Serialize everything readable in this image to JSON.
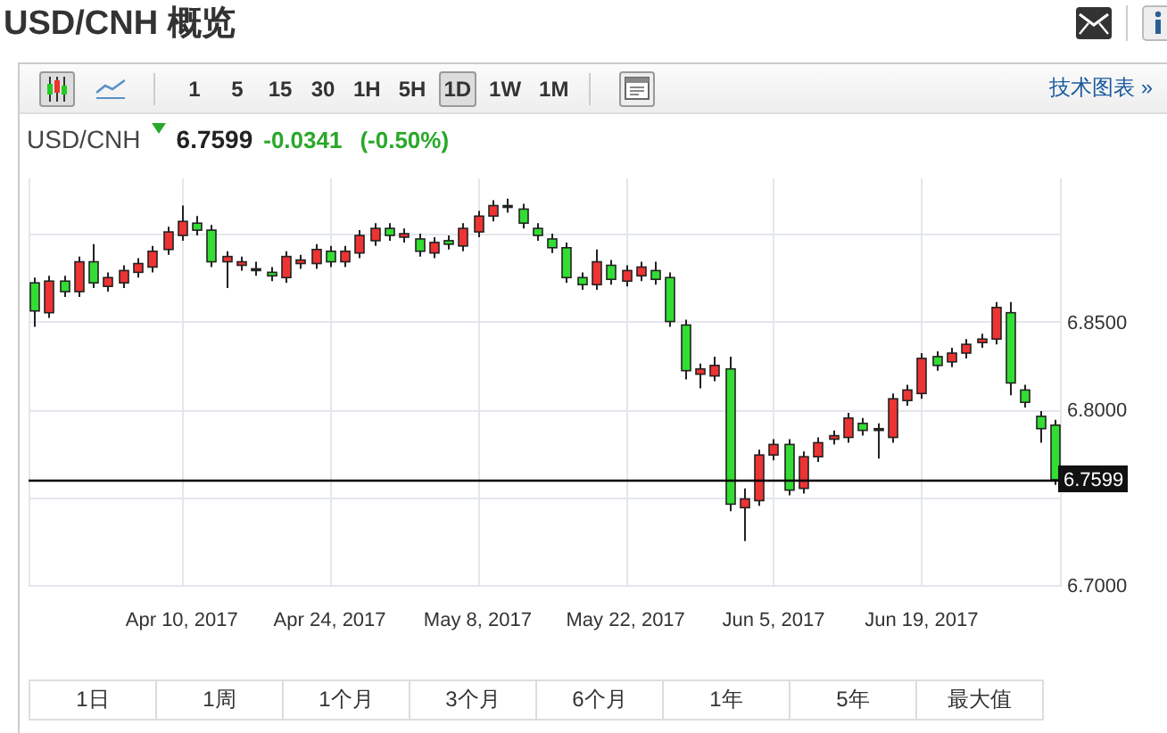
{
  "page_title": "USD/CNH 概览",
  "toolbar": {
    "chart_types": [
      {
        "kind": "candles",
        "selected": true
      },
      {
        "kind": "line",
        "selected": false
      }
    ],
    "intervals": [
      {
        "label": "1",
        "selected": false
      },
      {
        "label": "5",
        "selected": false
      },
      {
        "label": "15",
        "selected": false
      },
      {
        "label": "30",
        "selected": false
      },
      {
        "label": "1H",
        "selected": false
      },
      {
        "label": "5H",
        "selected": false
      },
      {
        "label": "1D",
        "selected": true
      },
      {
        "label": "1W",
        "selected": false
      },
      {
        "label": "1M",
        "selected": false
      }
    ],
    "link": "技术图表 »"
  },
  "quote": {
    "symbol": "USD/CNH",
    "falling": true,
    "price": "6.7599",
    "change": "-0.0341",
    "change_percent": "(-0.50%)"
  },
  "chart": {
    "chart_data": {
      "type": "candlestick",
      "ylim": [
        6.7,
        6.9315
      ],
      "grid": true,
      "categories": [
        null,
        null,
        null,
        null,
        null,
        null,
        null,
        null,
        null,
        null,
        "Apr 10, 2017",
        null,
        null,
        null,
        null,
        null,
        null,
        null,
        null,
        null,
        "Apr 24, 2017",
        null,
        null,
        null,
        null,
        null,
        null,
        null,
        null,
        null,
        "May 8, 2017",
        null,
        null,
        null,
        null,
        null,
        null,
        null,
        null,
        null,
        "May 22, 2017",
        null,
        null,
        null,
        null,
        null,
        null,
        null,
        null,
        null,
        "Jun 5, 2017",
        null,
        null,
        null,
        null,
        null,
        null,
        null,
        null,
        null,
        "Jun 19, 2017",
        null,
        null,
        null,
        null,
        null,
        null,
        null,
        null,
        null
      ],
      "ref_lines": [
        {
          "axis": "y",
          "value": 6.7599,
          "label": "6.7599"
        }
      ],
      "yticks": [
        {
          "value": 6.85,
          "label": "6.8500"
        },
        {
          "value": 6.8,
          "label": "6.8000"
        },
        {
          "value": 6.7,
          "label": "6.7000"
        }
      ],
      "ohlc": [
        [
          6.872,
          6.875,
          6.847,
          6.856
        ],
        [
          6.855,
          6.876,
          6.852,
          6.873
        ],
        [
          6.873,
          6.876,
          6.864,
          6.867
        ],
        [
          6.867,
          6.887,
          6.864,
          6.884
        ],
        [
          6.884,
          6.894,
          6.869,
          6.872
        ],
        [
          6.87,
          6.878,
          6.867,
          6.875
        ],
        [
          6.872,
          6.882,
          6.869,
          6.879
        ],
        [
          6.878,
          6.886,
          6.875,
          6.883
        ],
        [
          6.881,
          6.893,
          6.878,
          6.89
        ],
        [
          6.891,
          6.904,
          6.888,
          6.901
        ],
        [
          6.899,
          6.916,
          6.896,
          6.907
        ],
        [
          6.906,
          6.91,
          6.899,
          6.902
        ],
        [
          6.902,
          6.905,
          6.881,
          6.884
        ],
        [
          6.884,
          6.89,
          6.869,
          6.887
        ],
        [
          6.882,
          6.887,
          6.879,
          6.884
        ],
        [
          6.88,
          6.884,
          6.876,
          6.879
        ],
        [
          6.878,
          6.881,
          6.873,
          6.876
        ],
        [
          6.875,
          6.89,
          6.872,
          6.887
        ],
        [
          6.883,
          6.888,
          6.88,
          6.885
        ],
        [
          6.883,
          6.894,
          6.88,
          6.891
        ],
        [
          6.89,
          6.893,
          6.881,
          6.884
        ],
        [
          6.884,
          6.893,
          6.881,
          6.89
        ],
        [
          6.889,
          6.902,
          6.886,
          6.899
        ],
        [
          6.896,
          6.906,
          6.893,
          6.903
        ],
        [
          6.903,
          6.906,
          6.896,
          6.899
        ],
        [
          6.898,
          6.903,
          6.895,
          6.9
        ],
        [
          6.897,
          6.9,
          6.887,
          6.89
        ],
        [
          6.889,
          6.898,
          6.886,
          6.895
        ],
        [
          6.896,
          6.899,
          6.891,
          6.894
        ],
        [
          6.893,
          6.906,
          6.89,
          6.903
        ],
        [
          6.901,
          6.913,
          6.898,
          6.91
        ],
        [
          6.91,
          6.919,
          6.907,
          6.916
        ],
        [
          6.916,
          6.92,
          6.912,
          6.915
        ],
        [
          6.914,
          6.917,
          6.903,
          6.906
        ],
        [
          6.903,
          6.906,
          6.896,
          6.899
        ],
        [
          6.897,
          6.9,
          6.889,
          6.892
        ],
        [
          6.892,
          6.895,
          6.872,
          6.875
        ],
        [
          6.875,
          6.878,
          6.868,
          6.871
        ],
        [
          6.871,
          6.891,
          6.868,
          6.884
        ],
        [
          6.882,
          6.885,
          6.871,
          6.874
        ],
        [
          6.873,
          6.882,
          6.87,
          6.879
        ],
        [
          6.876,
          6.884,
          6.873,
          6.881
        ],
        [
          6.879,
          6.884,
          6.871,
          6.874
        ],
        [
          6.875,
          6.878,
          6.847,
          6.85
        ],
        [
          6.848,
          6.851,
          6.817,
          6.822
        ],
        [
          6.82,
          6.826,
          6.812,
          6.823
        ],
        [
          6.819,
          6.83,
          6.816,
          6.825
        ],
        [
          6.823,
          6.83,
          6.742,
          6.746
        ],
        [
          6.744,
          6.755,
          6.725,
          6.749
        ],
        [
          6.748,
          6.777,
          6.745,
          6.774
        ],
        [
          6.774,
          6.783,
          6.771,
          6.78
        ],
        [
          6.78,
          6.783,
          6.751,
          6.754
        ],
        [
          6.755,
          6.776,
          6.752,
          6.773
        ],
        [
          6.773,
          6.784,
          6.77,
          6.781
        ],
        [
          6.783,
          6.788,
          6.78,
          6.785
        ],
        [
          6.784,
          6.798,
          6.781,
          6.795
        ],
        [
          6.792,
          6.795,
          6.785,
          6.788
        ],
        [
          6.789,
          6.792,
          6.772,
          6.788
        ],
        [
          6.784,
          6.809,
          6.781,
          6.806
        ],
        [
          6.805,
          6.814,
          6.802,
          6.811
        ],
        [
          6.809,
          6.832,
          6.806,
          6.829
        ],
        [
          6.83,
          6.833,
          6.822,
          6.825
        ],
        [
          6.827,
          6.835,
          6.824,
          6.832
        ],
        [
          6.832,
          6.84,
          6.829,
          6.837
        ],
        [
          6.838,
          6.843,
          6.835,
          6.84
        ],
        [
          6.84,
          6.861,
          6.837,
          6.858
        ],
        [
          6.855,
          6.861,
          6.808,
          6.815
        ],
        [
          6.811,
          6.814,
          6.801,
          6.804
        ],
        [
          6.796,
          6.799,
          6.781,
          6.789
        ],
        [
          6.791,
          6.794,
          6.757,
          6.7599
        ]
      ]
    }
  },
  "ranges": [
    {
      "label": "1日"
    },
    {
      "label": "1周"
    },
    {
      "label": "1个月"
    },
    {
      "label": "3个月"
    },
    {
      "label": "6个月"
    },
    {
      "label": "1年"
    },
    {
      "label": "5年"
    },
    {
      "label": "最大值"
    }
  ]
}
